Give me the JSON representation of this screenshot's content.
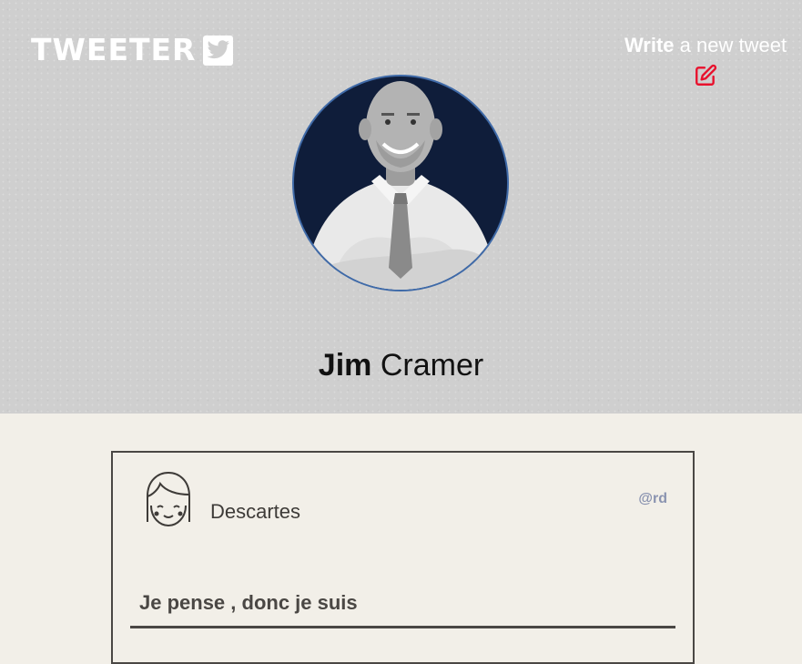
{
  "header": {
    "logo_text": "TWEETER",
    "write_strong": "Write",
    "write_rest": " a new tweet",
    "icons": {
      "logo": "twitter-bird-icon",
      "compose": "edit-icon"
    },
    "colors": {
      "accent": "#e8112d",
      "header_bg": "#cfcfcf"
    }
  },
  "profile": {
    "first_name": "Jim",
    "last_name": " Cramer"
  },
  "tweets": [
    {
      "author": "Descartes",
      "handle": "@rd",
      "text": "Je pense , donc je suis"
    }
  ]
}
